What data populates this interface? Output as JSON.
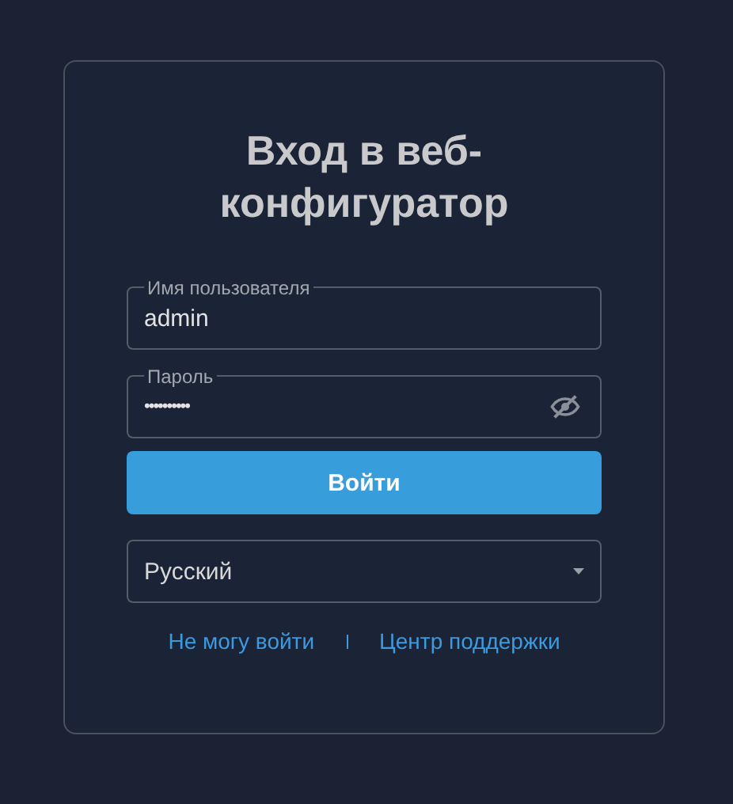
{
  "title": "Вход в веб-конфигуратор",
  "fields": [
    {
      "kind": "text",
      "label": "Имя пользователя",
      "value": "admin"
    },
    {
      "kind": "password",
      "label": "Пароль",
      "value": "••••••••••"
    }
  ],
  "submit_button": "Войти",
  "language_select": {
    "value": "Русский"
  },
  "links": [
    "Не могу войти",
    "Центр поддержки"
  ]
}
